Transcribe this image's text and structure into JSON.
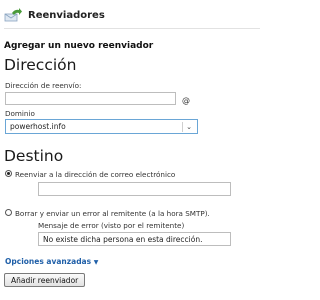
{
  "header": {
    "title": "Reenviadores",
    "icon": "forwarder-arrow-icon",
    "icon_color": "#4a9a3a"
  },
  "form": {
    "section_title": "Agregar un nuevo reenviador",
    "address": {
      "heading": "Dirección",
      "forward_label": "Dirección de reenvío:",
      "forward_value": "",
      "at_symbol": "@",
      "domain_label": "Dominio",
      "domain_selected": "powerhost.info"
    },
    "destination": {
      "heading": "Destino",
      "option_forward": "Reenviar a la dirección de correo electrónico",
      "forward_email_value": "",
      "option_discard": "Borrar y enviar un error al remitente (a la hora SMTP).",
      "error_message_label": "Mensaje de error (visto por el remitente)",
      "error_message_value": "No existe dicha persona en esta dirección."
    },
    "advanced_options": "Opciones avanzadas",
    "submit_label": "Añadir reenviador"
  }
}
